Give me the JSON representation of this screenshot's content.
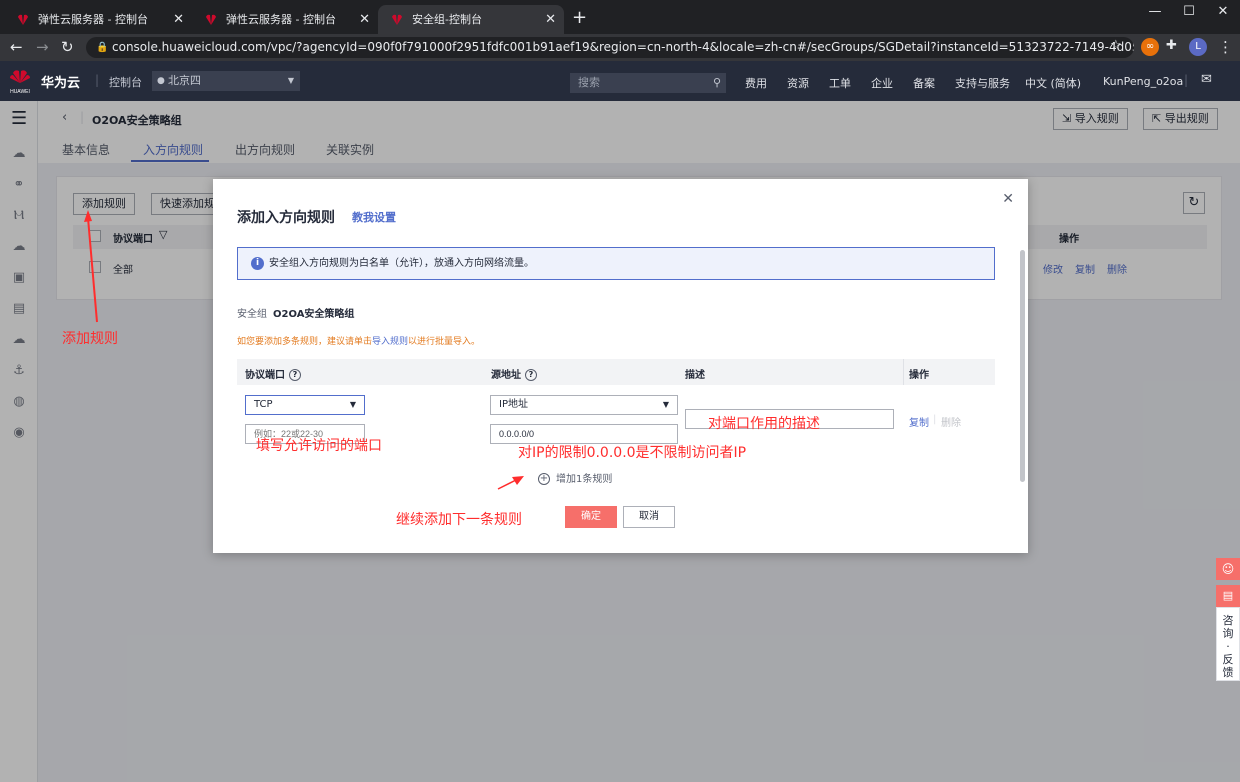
{
  "browser": {
    "tabs": [
      {
        "label": "弹性云服务器 - 控制台",
        "active": false
      },
      {
        "label": "弹性云服务器 - 控制台",
        "active": false
      },
      {
        "label": "安全组-控制台",
        "active": true
      }
    ],
    "url": "console.huaweicloud.com/vpc/?agencyId=090f0f791000f2951fdfc001b91aef19&region=cn-north-4&locale=zh-cn#/secGroups/SGDetail?instanceId=51323722-7149-4d05-a383-3ae963ac5...",
    "profile_initial": "L"
  },
  "topnav": {
    "brand": "华为云",
    "logo_text": "HUAWEI",
    "console": "控制台",
    "region": "北京四",
    "search_placeholder": "搜索",
    "items": [
      "费用",
      "资源",
      "工单",
      "企业",
      "备案",
      "支持与服务",
      "中文 (简体)",
      "KunPeng_o2oa"
    ]
  },
  "page": {
    "title": "O2OA安全策略组",
    "import_btn": "导入规则",
    "export_btn": "导出规则",
    "tabs": [
      "基本信息",
      "入方向规则",
      "出方向规则",
      "关联实例"
    ],
    "active_tab": 1,
    "bg_table": {
      "add_btn": "添加规则",
      "quick_btn": "快速添加规",
      "col_port": "协议端口",
      "col_ops": "操作",
      "row_value": "全部",
      "ops": [
        "修改",
        "复制",
        "删除"
      ]
    }
  },
  "dialog": {
    "title": "添加入方向规则",
    "help": "教我设置",
    "info": "安全组入方向规则为白名单（允许），放通入方向网络流量。",
    "sg_label": "安全组",
    "sg_name": "O2OA安全策略组",
    "warn_before": "如您要添加多条规则，建议请单击",
    "warn_link": "导入规则",
    "warn_after": "以进行批量导入。",
    "columns": [
      "协议端口",
      "源地址",
      "描述",
      "操作"
    ],
    "protocol": "TCP",
    "port_placeholder": "例如：22或22-30",
    "source_type": "IP地址",
    "source_value": "0.0.0.0/0",
    "row_copy": "复制",
    "row_delete": "删除",
    "add_more": "增加1条规则",
    "ok": "确定",
    "cancel": "取消"
  },
  "annotations": {
    "add_rule": "添加规则",
    "port_hint": "填写允许访问的端口",
    "ip_hint": "对IP的限制0.0.0.0是不限制访问者IP",
    "desc_hint": "对端口作用的描述",
    "continue_hint": "继续添加下一条规则",
    "color": "#ff2d2d"
  },
  "feedback": {
    "text_chars": [
      "咨",
      "询",
      "·",
      "反",
      "馈"
    ]
  },
  "colors": {
    "accent": "#526ecc",
    "primary_button": "#f66f6a",
    "header_bg": "#252b3a",
    "warn": "#e37b20"
  }
}
